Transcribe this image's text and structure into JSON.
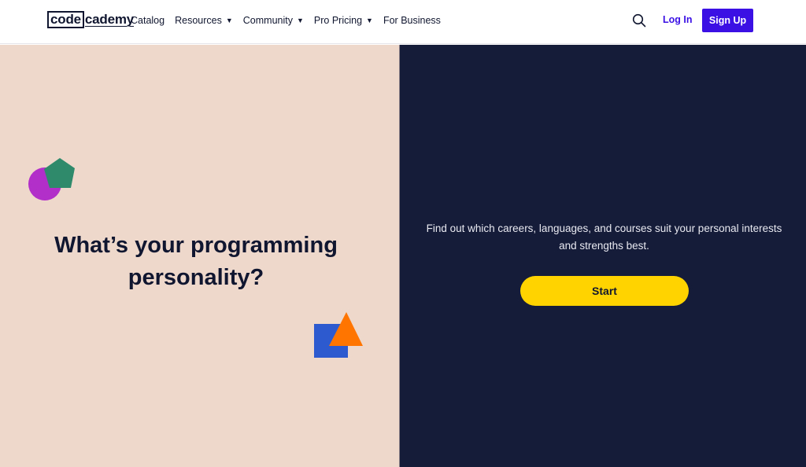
{
  "header": {
    "logo": {
      "boxed": "code",
      "rest": "cademy"
    },
    "nav": [
      {
        "label": "Catalog",
        "has_dropdown": false
      },
      {
        "label": "Resources",
        "has_dropdown": true
      },
      {
        "label": "Community",
        "has_dropdown": true
      },
      {
        "label": "Pro Pricing",
        "has_dropdown": true
      },
      {
        "label": "For Business",
        "has_dropdown": false
      }
    ],
    "caret": "▼",
    "search_icon": "search-icon",
    "login_label": "Log In",
    "signup_label": "Sign Up"
  },
  "hero": {
    "headline_line1": "What’s your programming",
    "headline_line2": "personality?",
    "description": "Find out which careers, languages, and courses suit your personal interests and strengths best.",
    "start_label": "Start"
  },
  "colors": {
    "brand_blue": "#3a10e5",
    "navy": "#141c3a",
    "peach": "#eed8cb",
    "yellow": "#ffd300",
    "purple": "#b22fc9",
    "green": "#2f8a6b",
    "blue": "#2d5bcf",
    "orange": "#ff7500"
  }
}
